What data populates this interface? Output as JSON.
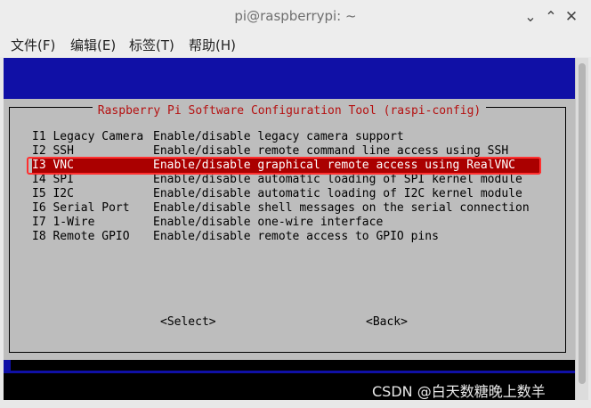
{
  "window": {
    "title": "pi@raspberrypi: ~",
    "minimize_glyph": "⌄",
    "maximize_glyph": "⌃",
    "close_glyph": "✕"
  },
  "menubar": {
    "items": [
      {
        "label": "文件(F)"
      },
      {
        "label": "编辑(E)"
      },
      {
        "label": "标签(T)"
      },
      {
        "label": "帮助(H)"
      }
    ]
  },
  "dialog": {
    "title": "Raspberry Pi Software Configuration Tool (raspi-config)",
    "options": [
      {
        "code": "I1 Legacy Camera",
        "desc": "Enable/disable legacy camera support"
      },
      {
        "code": "I2 SSH",
        "desc": "Enable/disable remote command line access using SSH"
      },
      {
        "code": "I3 VNC",
        "desc": "Enable/disable graphical remote access using RealVNC",
        "selected": true
      },
      {
        "code": "I4 SPI",
        "desc": "Enable/disable automatic loading of SPI kernel module"
      },
      {
        "code": "I5 I2C",
        "desc": "Enable/disable automatic loading of I2C kernel module"
      },
      {
        "code": "I6 Serial Port",
        "desc": "Enable/disable shell messages on the serial connection"
      },
      {
        "code": "I7 1-Wire",
        "desc": "Enable/disable one-wire interface"
      },
      {
        "code": "I8 Remote GPIO",
        "desc": "Enable/disable remote access to GPIO pins"
      }
    ],
    "select_label": "<Select>",
    "back_label": "<Back>"
  },
  "watermark": "CSDN @白天数糖晚上数羊",
  "colors": {
    "terminal_bg": "#1010a6",
    "dialog_bg": "#bdbdbd",
    "title_red": "#b51010",
    "selected_bg": "#aa0000",
    "highlight_outline": "#ff3030"
  }
}
